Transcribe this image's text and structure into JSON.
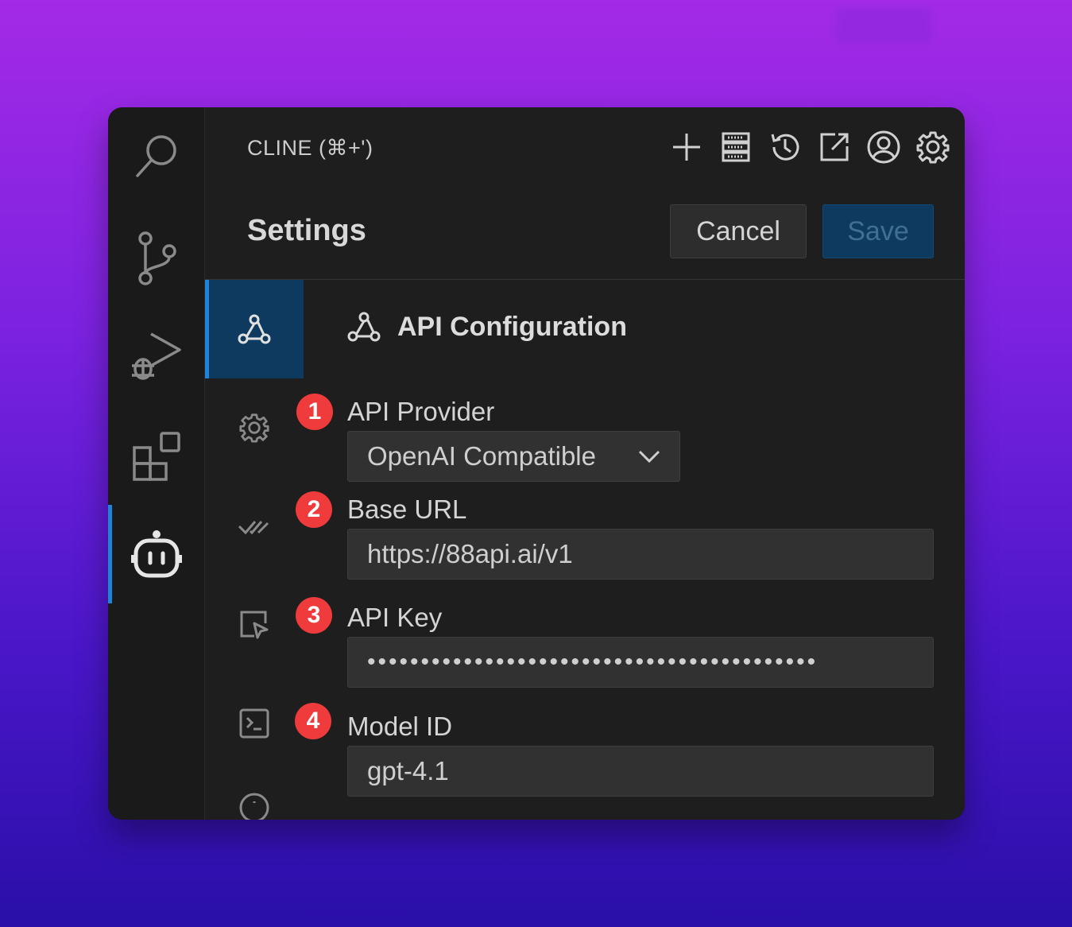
{
  "window": {
    "title": "CLINE (⌘+')"
  },
  "activity_bar": {
    "items": [
      "search",
      "source-control",
      "run-debug",
      "extensions",
      "cline"
    ]
  },
  "title_actions": [
    "new-task",
    "mcp-servers",
    "history",
    "open-in-editor",
    "account",
    "settings"
  ],
  "settings": {
    "title": "Settings",
    "cancel_label": "Cancel",
    "save_label": "Save",
    "section_title": "API Configuration"
  },
  "fields": {
    "api_provider": {
      "badge": "1",
      "label": "API Provider",
      "value": "OpenAI Compatible"
    },
    "base_url": {
      "badge": "2",
      "label": "Base URL",
      "value": "https://88api.ai/v1"
    },
    "api_key": {
      "badge": "3",
      "label": "API Key",
      "value": "••••••••••••••••••••••••••••••••••••••••••"
    },
    "model_id": {
      "badge": "4",
      "label": "Model ID",
      "value": "gpt-4.1"
    }
  },
  "colors": {
    "accent": "#1f84d8",
    "badge": "#ef3b3b",
    "save_bg": "#0e3a5f"
  }
}
